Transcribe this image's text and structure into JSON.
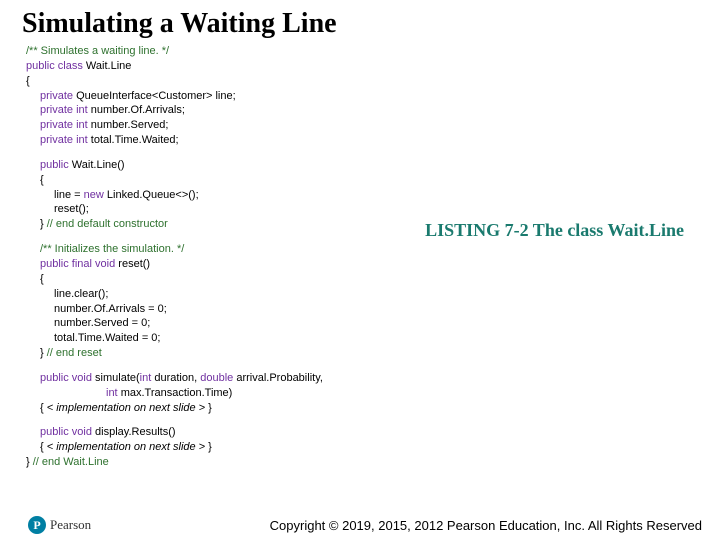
{
  "title": "Simulating a Waiting Line",
  "listing_caption": "LISTING 7-2 The class Wait.Line",
  "copyright": "Copyright © 2019, 2015, 2012 Pearson Education, Inc. All Rights Reserved",
  "logo": {
    "letter": "P",
    "brand": "Pearson"
  },
  "code": {
    "c01": "/** Simulates a waiting line. */",
    "k_public": "public ",
    "k_class": "class ",
    "c02b": "Wait.Line",
    "brace_open": "{",
    "k_private": "private ",
    "c03b": "QueueInterface<Customer> line;",
    "k_int": "int ",
    "c04b": "number.Of.Arrivals;",
    "c05b": "number.Served;",
    "c06b": "total.Time.Waited;",
    "c07b": "Wait.Line()",
    "c08a": "line = ",
    "k_new": "new ",
    "c08c": "Linked.Queue<>();",
    "c09": "reset();",
    "c10a": "} ",
    "c10b": "// end default constructor",
    "c11": "/** Initializes the simulation. */",
    "k_final": "final ",
    "k_void": "void ",
    "c12b": "reset()",
    "c13": "line.clear();",
    "c14": "number.Of.Arrivals = 0;",
    "c15": "number.Served = 0;",
    "c16": "total.Time.Waited = 0;",
    "c17a": "} ",
    "c17b": "// end reset",
    "c18b": "simulate(",
    "c18d": "duration, ",
    "k_double": "double ",
    "c18f": "arrival.Probability,",
    "c19b": "max.Transaction.Time)",
    "c20a": "{  ",
    "c20b": "< implementation on next slide >",
    "c20c": "  }",
    "c21b": "display.Results()",
    "c22a": "{  ",
    "c22b": "< implementation on next slide >",
    "c22c": "   }",
    "c23a": "} ",
    "c23b": "// end Wait.Line"
  }
}
